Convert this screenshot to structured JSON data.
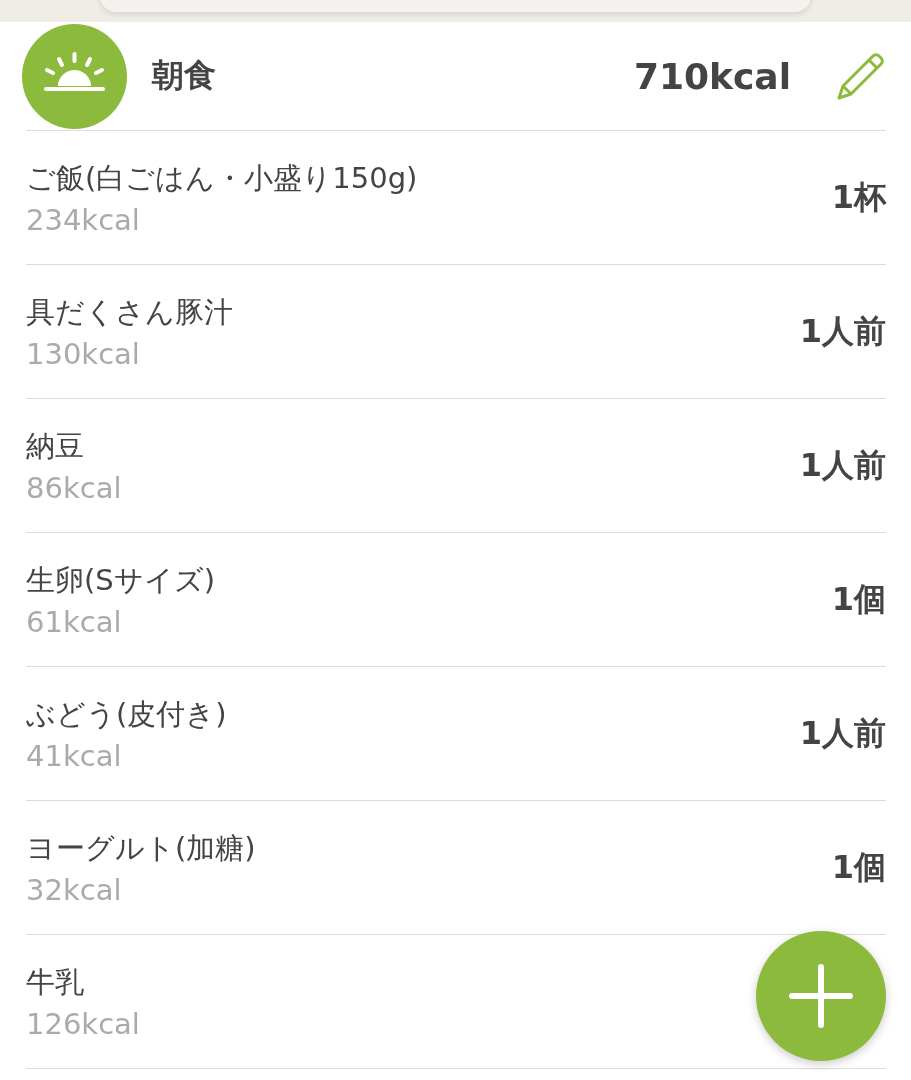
{
  "meal": {
    "title": "朝食",
    "total": "710kcal"
  },
  "items": [
    {
      "name": "ご飯(白ごはん・小盛り150g)",
      "kcal": "234kcal",
      "amount": "1杯"
    },
    {
      "name": "具だくさん豚汁",
      "kcal": "130kcal",
      "amount": "1人前"
    },
    {
      "name": "納豆",
      "kcal": "86kcal",
      "amount": "1人前"
    },
    {
      "name": "生卵(Sサイズ)",
      "kcal": "61kcal",
      "amount": "1個"
    },
    {
      "name": "ぶどう(皮付き)",
      "kcal": "41kcal",
      "amount": "1人前"
    },
    {
      "name": "ヨーグルト(加糖)",
      "kcal": "32kcal",
      "amount": "1個"
    },
    {
      "name": "牛乳",
      "kcal": "126kcal"
    }
  ]
}
